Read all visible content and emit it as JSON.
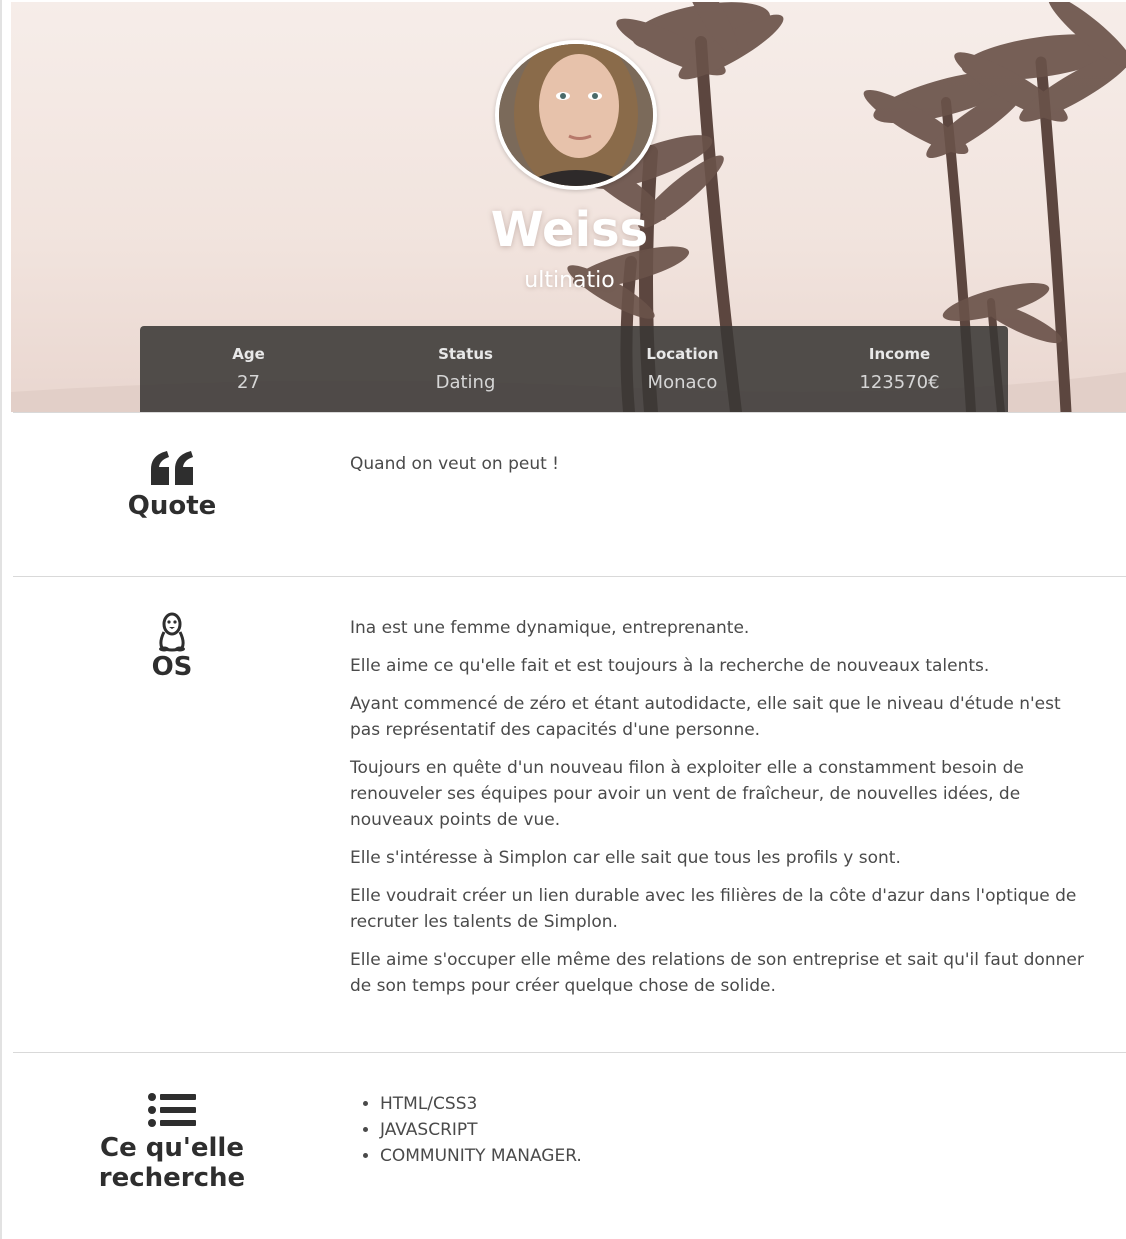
{
  "hero": {
    "name_visible": "Weiss",
    "subtitle_visible": "ultinatio",
    "stats": [
      {
        "label": "Age",
        "value": "27"
      },
      {
        "label": "Status",
        "value": "Dating"
      },
      {
        "label": "Location",
        "value": "Monaco"
      },
      {
        "label": "Income",
        "value": "123570€"
      }
    ]
  },
  "sections": {
    "quote": {
      "icon": "quote-icon",
      "title": "Quote",
      "text": "Quand on veut on peut !"
    },
    "os": {
      "icon": "linux-penguin-icon",
      "title": "OS",
      "paragraphs": [
        "Ina est une femme dynamique, entreprenante.",
        "Elle aime ce qu'elle fait et est toujours à la recherche de nouveaux talents.",
        "Ayant commencé de zéro et étant autodidacte, elle sait que le niveau d'étude n'est pas représentatif des capacités d'une personne.",
        "Toujours en quête d'un nouveau filon à exploiter elle a constamment besoin de renouveler ses équipes pour avoir un vent de fraîcheur, de nouvelles idées, de nouveaux points de vue.",
        "Elle s'intéresse à Simplon car elle sait que tous les profils y sont.",
        "Elle voudrait créer un lien durable avec les filières de la côte d'azur dans l'optique de recruter les talents de Simplon.",
        "Elle aime s'occuper elle même des relations de son entreprise et sait qu'il faut donner de son temps pour créer quelque chose de solide."
      ]
    },
    "search": {
      "icon": "list-icon",
      "title_line1": "Ce qu'elle",
      "title_line2": "recherche",
      "items": [
        "HTML/CSS3",
        "JAVASCRIPT",
        "COMMUNITY MANAGER."
      ]
    }
  },
  "colors": {
    "stats_bar": "#3a3836",
    "heading": "#2e2e2e",
    "body_text": "#4a4a4a",
    "divider": "#d9d9d9"
  }
}
